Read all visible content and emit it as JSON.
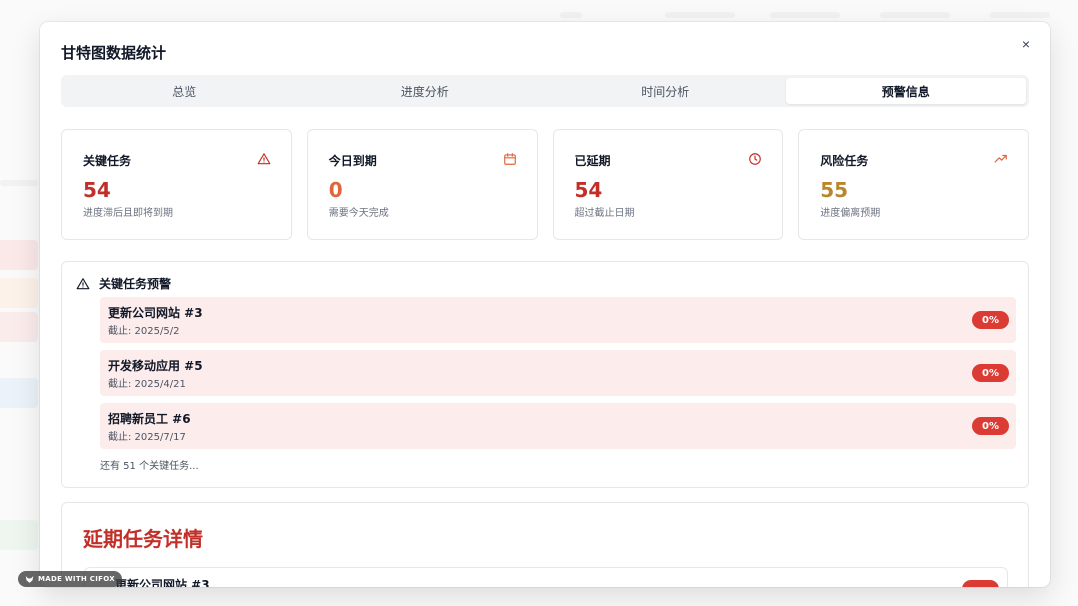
{
  "modal": {
    "title": "甘特图数据统计",
    "close_label": "×"
  },
  "tabs": [
    {
      "label": "总览",
      "active": false
    },
    {
      "label": "进度分析",
      "active": false
    },
    {
      "label": "时间分析",
      "active": false
    },
    {
      "label": "预警信息",
      "active": true
    }
  ],
  "stats": [
    {
      "label": "关键任务",
      "value": "54",
      "desc": "进度滞后且即将到期",
      "color": "#c22f29",
      "icon": "warning-triangle-icon"
    },
    {
      "label": "今日到期",
      "value": "0",
      "desc": "需要今天完成",
      "color": "#e0653a",
      "icon": "calendar-icon"
    },
    {
      "label": "已延期",
      "value": "54",
      "desc": "超过截止日期",
      "color": "#c22f29",
      "icon": "clock-icon"
    },
    {
      "label": "风险任务",
      "value": "55",
      "desc": "进度偏离预期",
      "color": "#b8862b",
      "icon": "trending-up-icon"
    }
  ],
  "critical": {
    "title": "关键任务预警",
    "icon": "warning-triangle-icon",
    "items": [
      {
        "name": "更新公司网站 #3",
        "due": "截止: 2025/5/2",
        "progress": "0%"
      },
      {
        "name": "开发移动应用 #5",
        "due": "截止: 2025/4/21",
        "progress": "0%"
      },
      {
        "name": "招聘新员工 #6",
        "due": "截止: 2025/7/17",
        "progress": "0%"
      }
    ],
    "more": "还有 51 个关键任务..."
  },
  "overdue": {
    "title": "延期任务详情",
    "first_item": "更新公司网站 #3"
  },
  "watermark": "MADE WITH CIFOX",
  "colors": {
    "danger": "#dc3b34",
    "danger_bg": "#fdecec",
    "warning_orange": "#e0653a",
    "risk_gold": "#b8862b"
  }
}
